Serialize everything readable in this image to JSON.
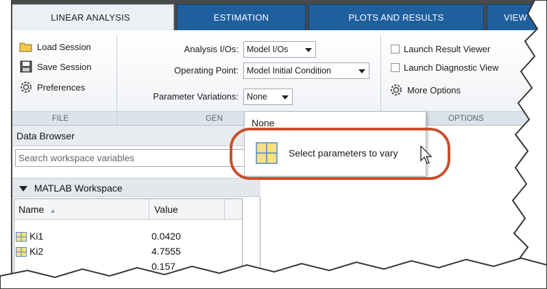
{
  "tabs": [
    {
      "label": "LINEAR ANALYSIS"
    },
    {
      "label": "ESTIMATION"
    },
    {
      "label": "PLOTS AND RESULTS"
    },
    {
      "label": "VIEW"
    }
  ],
  "file_section": {
    "load_session": "Load Session",
    "save_session": "Save Session",
    "preferences": "Preferences",
    "footer": "FILE"
  },
  "general_section": {
    "analysis_ios_label": "Analysis I/Os:",
    "analysis_ios_value": "Model I/Os",
    "operating_point_label": "Operating Point:",
    "operating_point_value": "Model Initial Condition",
    "parameter_variations_label": "Parameter Variations:",
    "parameter_variations_value": "None",
    "footer": "GEN"
  },
  "options_section": {
    "launch_result_viewer": "Launch Result Viewer",
    "launch_diagnostic_viewer": "Launch Diagnostic View",
    "more_options": "More Options",
    "footer": "OPTIONS"
  },
  "dropdown": {
    "items": [
      {
        "label": "None"
      },
      {
        "label": "Select parameters to vary"
      }
    ]
  },
  "data_browser": {
    "title": "Data Browser",
    "search_placeholder": "Search workspace variables",
    "workspace_label": "MATLAB Workspace",
    "columns": [
      "Name",
      "Value"
    ],
    "rows": [
      {
        "name": "Ki1",
        "value": "0.0420"
      },
      {
        "name": "Ki2",
        "value": "4.7555"
      },
      {
        "name": "",
        "value": "0.157"
      }
    ]
  },
  "colors": {
    "tab_active_bg": "#eceff3",
    "tab_bg": "#1f5f9e",
    "highlight": "#c7502a"
  }
}
